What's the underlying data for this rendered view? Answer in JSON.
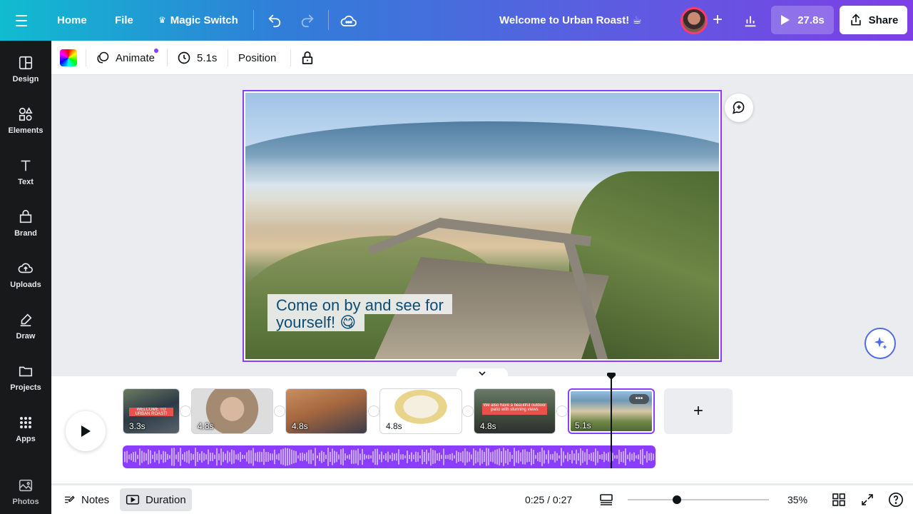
{
  "topbar": {
    "home": "Home",
    "file": "File",
    "magic_switch": "Magic Switch",
    "doc_title": "Welcome to Urban Roast! ☕",
    "present_duration": "27.8s",
    "share": "Share"
  },
  "sidebar": {
    "items": [
      {
        "label": "Design",
        "icon": "layout-icon"
      },
      {
        "label": "Elements",
        "icon": "shapes-icon"
      },
      {
        "label": "Text",
        "icon": "text-icon"
      },
      {
        "label": "Brand",
        "icon": "brand-icon"
      },
      {
        "label": "Uploads",
        "icon": "cloud-upload-icon"
      },
      {
        "label": "Draw",
        "icon": "pen-icon"
      },
      {
        "label": "Projects",
        "icon": "folder-icon"
      },
      {
        "label": "Apps",
        "icon": "apps-grid-icon"
      },
      {
        "label": "Photos",
        "icon": "image-icon"
      }
    ]
  },
  "context_toolbar": {
    "animate": "Animate",
    "duration": "5.1s",
    "position": "Position"
  },
  "canvas": {
    "caption_line1": "Come on by and see for",
    "caption_line2": "yourself! 😋"
  },
  "timeline": {
    "clips": [
      {
        "duration": "3.3s",
        "caption": "WELCOME TO URBAN ROAST!"
      },
      {
        "duration": "4.8s"
      },
      {
        "duration": "4.8s"
      },
      {
        "duration": "4.8s"
      },
      {
        "duration": "4.8s",
        "caption": "We also have a beautiful outdoor patio with stunning views"
      },
      {
        "duration": "5.1s",
        "more": "•••"
      }
    ],
    "add_page": "+"
  },
  "bottombar": {
    "notes": "Notes",
    "duration": "Duration",
    "time": "0:25 / 0:27",
    "zoom": "35%",
    "zoom_level": 0.35
  },
  "colors": {
    "accent": "#8b3dff",
    "sidebar_bg": "#18191b",
    "gradient_start": "#10bcd0",
    "gradient_end": "#7d3fe6"
  }
}
